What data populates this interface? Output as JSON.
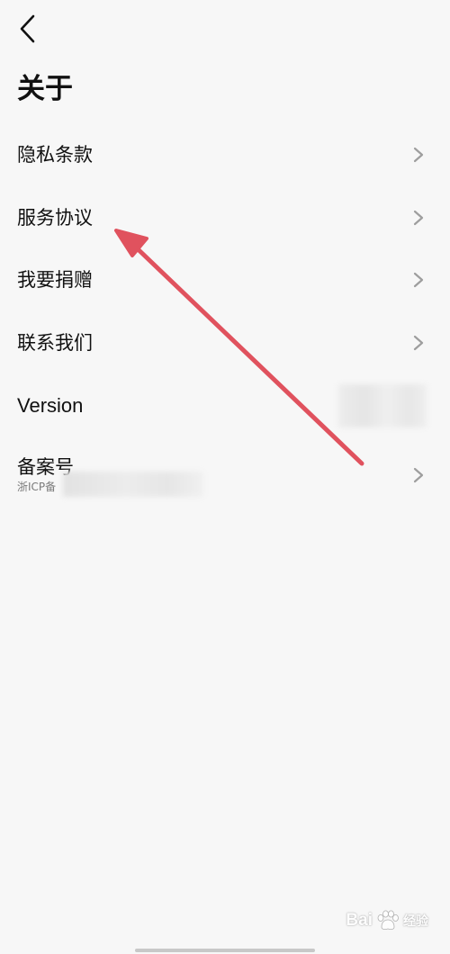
{
  "header": {
    "title": "关于"
  },
  "menu": {
    "privacy": "隐私条款",
    "service": "服务协议",
    "donate": "我要捐赠",
    "contact": "联系我们",
    "version": "Version",
    "beian_title": "备案号",
    "beian_sub": "浙ICP备"
  },
  "watermark": {
    "brand": "Bai",
    "sub": "经验"
  },
  "colors": {
    "background": "#f7f7f7",
    "chevron": "#9e9e9e",
    "annotation_arrow": "#e0525e"
  },
  "icons": {
    "back": "back-chevron-icon",
    "row": "chevron-right-icon",
    "watermark": "paw-icon"
  }
}
